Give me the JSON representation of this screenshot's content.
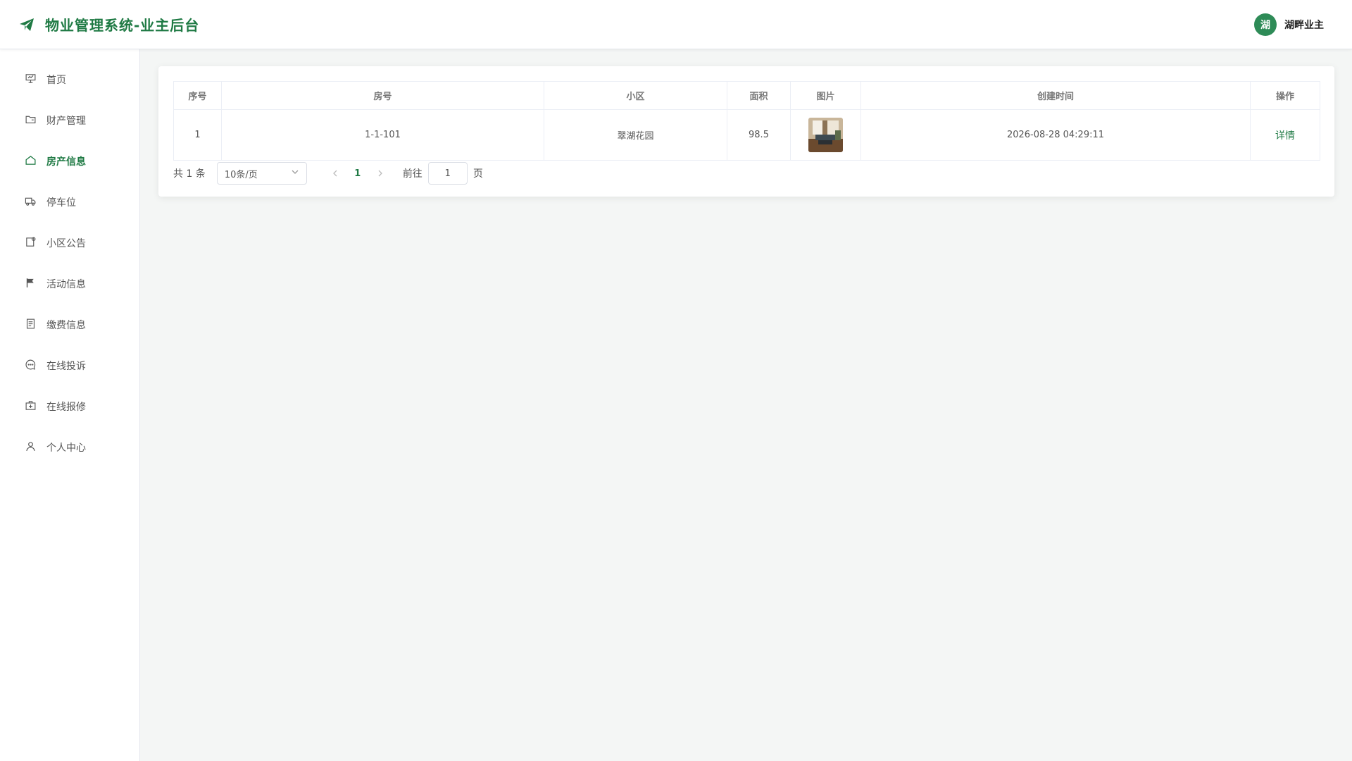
{
  "header": {
    "title": "物业管理系统-业主后台",
    "brand_icon": "paper-plane-icon",
    "user": {
      "avatar_text": "湖",
      "name": "湖畔业主"
    }
  },
  "sidebar": {
    "items": [
      {
        "label": "首页",
        "icon": "presentation-icon"
      },
      {
        "label": "财产管理",
        "icon": "folder-icon"
      },
      {
        "label": "房产信息",
        "icon": "house-icon",
        "active": true
      },
      {
        "label": "停车位",
        "icon": "truck-icon"
      },
      {
        "label": "小区公告",
        "icon": "notice-icon"
      },
      {
        "label": "活动信息",
        "icon": "flag-icon"
      },
      {
        "label": "缴费信息",
        "icon": "document-icon"
      },
      {
        "label": "在线投诉",
        "icon": "chat-icon"
      },
      {
        "label": "在线报修",
        "icon": "first-aid-kit-icon"
      },
      {
        "label": "个人中心",
        "icon": "user-icon"
      }
    ]
  },
  "table": {
    "columns": [
      "序号",
      "房号",
      "小区",
      "面积",
      "图片",
      "创建时间",
      "操作"
    ],
    "rows": [
      {
        "index": "1",
        "room": "1-1-101",
        "community": "翠湖花园",
        "area": "98.5",
        "image": "room-photo-thumbnail",
        "created": "2026-08-28 04:29:11",
        "action": "详情"
      }
    ]
  },
  "pagination": {
    "total": "共 1 条",
    "page_size": "10条/页",
    "current_page": "1",
    "goto_label": "前往",
    "goto_value": "1",
    "page_suffix": "页"
  },
  "colors": {
    "accent": "#1f7a44",
    "avatar_bg": "#2e8b57",
    "background": "#f4f6f5"
  }
}
